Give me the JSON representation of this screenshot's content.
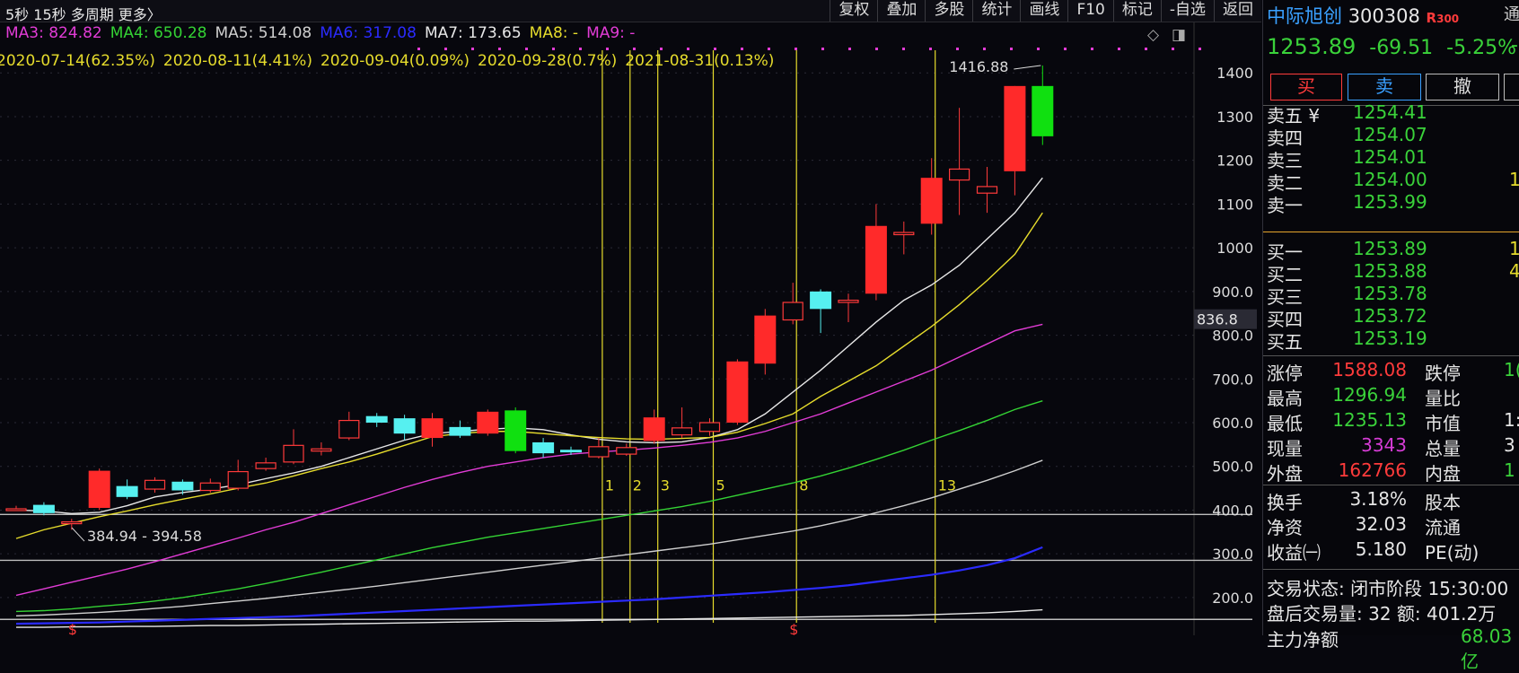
{
  "toolbar": {
    "left": "5秒  15秒  多周期  更多〉",
    "buttons": [
      "复权",
      "叠加",
      "多股",
      "统计",
      "画线",
      "F10",
      "标记",
      "-自选",
      "返回"
    ]
  },
  "ma_legend": [
    {
      "label": "MA3: 824.82",
      "color": "#e23cd6"
    },
    {
      "label": "MA4: 650.28",
      "color": "#34d334"
    },
    {
      "label": "MA5: 514.08",
      "color": "#cfcfcf"
    },
    {
      "label": "MA6: 317.08",
      "color": "#2b2bff"
    },
    {
      "label": "MA7: 173.65",
      "color": "#e8e8e8"
    },
    {
      "label": "MA8: -",
      "color": "#e6dc2c"
    },
    {
      "label": "MA9: -",
      "color": "#e23cd6"
    }
  ],
  "date_legend": [
    "2020-07-14(62.35%)",
    "2020-08-11(4.41%)",
    "2020-09-04(0.09%)",
    "2020-09-28(0.7%)",
    "2021-08-31(0.13%)"
  ],
  "chart_data": {
    "type": "candlestick",
    "ylim": [
      130,
      1460
    ],
    "y_ticks": [
      200,
      300,
      400,
      500,
      600,
      700,
      800,
      900,
      1000,
      1100,
      1200,
      1300,
      1400
    ],
    "y_tick_labels": [
      "200.0",
      "300.0",
      "400.0",
      "500.0",
      "600.0",
      "700.0",
      "800.0",
      "900.0",
      "1000",
      "1100",
      "1200",
      "1300",
      "1400"
    ],
    "candles": [
      {
        "o": 403,
        "c": 403,
        "h": 410,
        "l": 400
      },
      {
        "o": 412,
        "c": 393,
        "h": 418,
        "l": 388
      },
      {
        "o": 370,
        "c": 373,
        "h": 380,
        "l": 355
      },
      {
        "o": 405,
        "c": 490,
        "h": 495,
        "l": 400
      },
      {
        "o": 455,
        "c": 430,
        "h": 470,
        "l": 425
      },
      {
        "o": 448,
        "c": 468,
        "h": 475,
        "l": 440
      },
      {
        "o": 465,
        "c": 445,
        "h": 470,
        "l": 435
      },
      {
        "o": 445,
        "c": 462,
        "h": 472,
        "l": 440
      },
      {
        "o": 450,
        "c": 488,
        "h": 515,
        "l": 445
      },
      {
        "o": 495,
        "c": 508,
        "h": 520,
        "l": 490
      },
      {
        "o": 510,
        "c": 548,
        "h": 585,
        "l": 505
      },
      {
        "o": 535,
        "c": 540,
        "h": 555,
        "l": 525
      },
      {
        "o": 565,
        "c": 605,
        "h": 625,
        "l": 560
      },
      {
        "o": 615,
        "c": 600,
        "h": 622,
        "l": 590
      },
      {
        "o": 610,
        "c": 575,
        "h": 618,
        "l": 560
      },
      {
        "o": 565,
        "c": 610,
        "h": 622,
        "l": 545
      },
      {
        "o": 590,
        "c": 570,
        "h": 605,
        "l": 565
      },
      {
        "o": 575,
        "c": 625,
        "h": 630,
        "l": 570
      },
      {
        "o": 628,
        "c": 535,
        "h": 635,
        "l": 530
      },
      {
        "o": 555,
        "c": 530,
        "h": 565,
        "l": 520
      },
      {
        "o": 538,
        "c": 532,
        "h": 545,
        "l": 526
      },
      {
        "o": 522,
        "c": 545,
        "h": 565,
        "l": 518
      },
      {
        "o": 528,
        "c": 543,
        "h": 552,
        "l": 524
      },
      {
        "o": 558,
        "c": 612,
        "h": 630,
        "l": 552
      },
      {
        "o": 572,
        "c": 588,
        "h": 635,
        "l": 565
      },
      {
        "o": 580,
        "c": 600,
        "h": 610,
        "l": 570
      },
      {
        "o": 600,
        "c": 740,
        "h": 745,
        "l": 595
      },
      {
        "o": 735,
        "c": 845,
        "h": 860,
        "l": 710
      },
      {
        "o": 835,
        "c": 875,
        "h": 920,
        "l": 825
      },
      {
        "o": 900,
        "c": 860,
        "h": 905,
        "l": 805
      },
      {
        "o": 875,
        "c": 880,
        "h": 895,
        "l": 830
      },
      {
        "o": 895,
        "c": 1050,
        "h": 1100,
        "l": 880
      },
      {
        "o": 1030,
        "c": 1035,
        "h": 1060,
        "l": 985
      },
      {
        "o": 1055,
        "c": 1160,
        "h": 1205,
        "l": 1030
      },
      {
        "o": 1155,
        "c": 1180,
        "h": 1320,
        "l": 1075
      },
      {
        "o": 1125,
        "c": 1140,
        "h": 1185,
        "l": 1080
      },
      {
        "o": 1175,
        "c": 1370,
        "h": 1370,
        "l": 1120
      },
      {
        "o": 1370,
        "c": 1255,
        "h": 1416.88,
        "l": 1235.13
      }
    ],
    "lines": [
      {
        "name": "MA5",
        "color": "#e8e8e8",
        "values": [
          400,
          398,
          392,
          395,
          410,
          430,
          440,
          448,
          458,
          472,
          485,
          500,
          520,
          540,
          560,
          575,
          580,
          585,
          588,
          584,
          572,
          562,
          556,
          554,
          556,
          566,
          584,
          620,
          670,
          720,
          775,
          830,
          880,
          915,
          960,
          1020,
          1080,
          1160
        ]
      },
      {
        "name": "MA10",
        "color": "#e6dc2c",
        "values": [
          335,
          355,
          370,
          385,
          398,
          412,
          425,
          437,
          450,
          462,
          478,
          495,
          510,
          528,
          548,
          568,
          575,
          580,
          580,
          575,
          570,
          566,
          563,
          562,
          564,
          566,
          578,
          598,
          620,
          660,
          695,
          730,
          775,
          820,
          870,
          925,
          985,
          1080
        ]
      },
      {
        "name": "MA20",
        "color": "#e23cd6",
        "values": [
          205,
          220,
          235,
          250,
          265,
          282,
          300,
          318,
          336,
          355,
          372,
          392,
          412,
          432,
          452,
          470,
          486,
          500,
          510,
          520,
          528,
          533,
          537,
          542,
          548,
          555,
          565,
          580,
          600,
          620,
          645,
          670,
          695,
          720,
          750,
          780,
          810,
          825
        ]
      },
      {
        "name": "MA30",
        "color": "#34d334",
        "values": [
          168,
          170,
          174,
          180,
          185,
          192,
          200,
          210,
          220,
          232,
          245,
          258,
          272,
          286,
          300,
          314,
          326,
          338,
          348,
          358,
          368,
          378,
          388,
          398,
          408,
          420,
          434,
          448,
          462,
          478,
          496,
          516,
          537,
          560,
          582,
          605,
          630,
          650
        ]
      },
      {
        "name": "MA60",
        "color": "#cfcfcf",
        "values": [
          158,
          160,
          163,
          166,
          170,
          175,
          180,
          186,
          192,
          198,
          205,
          212,
          219,
          226,
          234,
          242,
          250,
          258,
          266,
          274,
          282,
          290,
          298,
          306,
          314,
          322,
          332,
          342,
          352,
          364,
          378,
          394,
          410,
          428,
          448,
          468,
          490,
          514
        ]
      },
      {
        "name": "MA120",
        "color": "#2b2bff",
        "values": [
          140,
          141,
          142,
          143,
          145,
          147,
          149,
          151,
          153,
          155,
          157,
          160,
          163,
          166,
          169,
          172,
          175,
          178,
          181,
          184,
          187,
          190,
          193,
          196,
          200,
          204,
          208,
          212,
          217,
          222,
          228,
          236,
          244,
          252,
          262,
          274,
          290,
          315
        ]
      },
      {
        "name": "MA250",
        "color": "#e8e8e8",
        "values": [
          132,
          132,
          133,
          133,
          134,
          134,
          135,
          136,
          136,
          137,
          138,
          139,
          140,
          141,
          142,
          143,
          144,
          145,
          146,
          146,
          147,
          148,
          149,
          150,
          151,
          152,
          153,
          154,
          155,
          156,
          157,
          158,
          159,
          161,
          163,
          165,
          168,
          172
        ]
      }
    ],
    "hlines": [
      390,
      285,
      150
    ],
    "vlines": [
      {
        "at": 21,
        "label": "1"
      },
      {
        "at": 22,
        "label": "2"
      },
      {
        "at": 23,
        "label": "3"
      },
      {
        "at": 25,
        "label": "5"
      },
      {
        "at": 28,
        "label": "8"
      },
      {
        "at": 33,
        "label": "13"
      }
    ],
    "high_label": "1416.88",
    "low_label": "384.94 - 394.58",
    "price_marker": "836.8"
  },
  "stock": {
    "name": "中际旭创",
    "code": "300308",
    "tag": "R",
    "tag_sub": "300",
    "tag_extra": "通",
    "price": "1253.89",
    "change": "-69.51",
    "change_pct": "-5.25%",
    "change_extra": "-"
  },
  "trade_buttons": [
    "买",
    "卖",
    "撤"
  ],
  "order_book": {
    "asks": [
      {
        "label": "卖五 ¥",
        "price": "1254.41",
        "vol": ""
      },
      {
        "label": "卖四",
        "price": "1254.07",
        "vol": ""
      },
      {
        "label": "卖三",
        "price": "1254.01",
        "vol": ""
      },
      {
        "label": "卖二",
        "price": "1254.00",
        "vol": "1"
      },
      {
        "label": "卖一",
        "price": "1253.99",
        "vol": ""
      }
    ],
    "bids": [
      {
        "label": "买一",
        "price": "1253.89",
        "vol": "1"
      },
      {
        "label": "买二",
        "price": "1253.88",
        "vol": "4"
      },
      {
        "label": "买三",
        "price": "1253.78",
        "vol": ""
      },
      {
        "label": "买四",
        "price": "1253.72",
        "vol": ""
      },
      {
        "label": "买五",
        "price": "1253.19",
        "vol": ""
      }
    ]
  },
  "stats": [
    {
      "l1": "涨停",
      "v1": "1588.08",
      "c1": "#ff3b3b",
      "l2": "跌停",
      "v2": "1(",
      "c2": "#3ad23a"
    },
    {
      "l1": "最高",
      "v1": "1296.94",
      "c1": "#3ad23a",
      "l2": "量比",
      "v2": "",
      "c2": "#e6e6e6"
    },
    {
      "l1": "最低",
      "v1": "1235.13",
      "c1": "#3ad23a",
      "l2": "市值",
      "v2": "1:",
      "c2": "#e6e6e6"
    },
    {
      "l1": "现量",
      "v1": "3343",
      "c1": "#d63cd6",
      "l2": "总量",
      "v2": "3",
      "c2": "#e6e6e6"
    },
    {
      "l1": "外盘",
      "v1": "162766",
      "c1": "#ff3b3b",
      "l2": "内盘",
      "v2": "1",
      "c2": "#3ad23a"
    }
  ],
  "stats2": [
    {
      "l1": "换手",
      "v1": "3.18%",
      "l2": "股本"
    },
    {
      "l1": "净资",
      "v1": "32.03",
      "l2": "流通"
    },
    {
      "l1": "收益㈠",
      "v1": "5.180",
      "l2": "PE(动)"
    }
  ],
  "status": {
    "line1": "交易状态: 闭市阶段 15:30:00",
    "line2": "盘后交易量: 32  额: 401.2万",
    "line3": "主力净额",
    "line3_value": "68.03亿"
  }
}
